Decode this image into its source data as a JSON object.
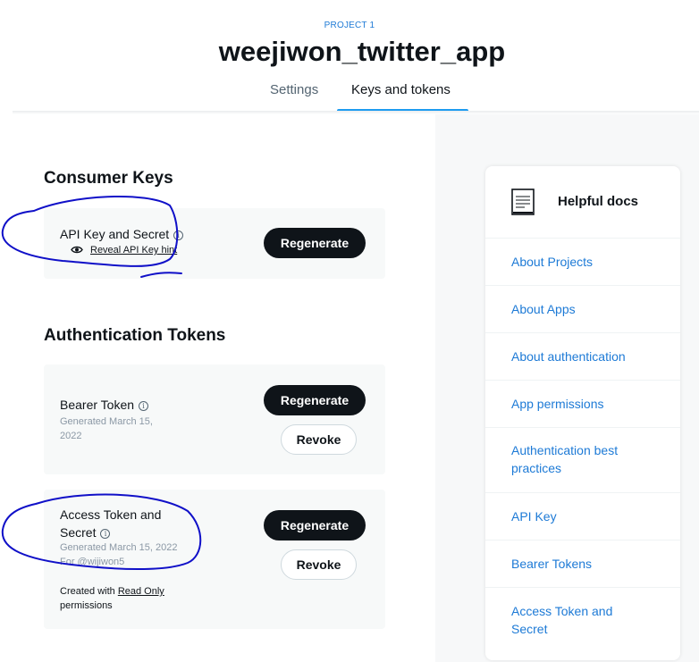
{
  "header": {
    "project_label": "PROJECT 1",
    "app_title": "weejiwon_twitter_app",
    "tabs": [
      {
        "label": "Settings",
        "active": false
      },
      {
        "label": "Keys and tokens",
        "active": true
      }
    ]
  },
  "consumer_keys": {
    "section_title": "Consumer Keys",
    "api_key": {
      "label": "API Key and Secret",
      "reveal_link": "Reveal API Key hint",
      "regenerate_label": "Regenerate"
    }
  },
  "auth_tokens": {
    "section_title": "Authentication Tokens",
    "bearer": {
      "label": "Bearer Token",
      "generated_line1": "Generated March 15,",
      "generated_line2": "2022",
      "regenerate_label": "Regenerate",
      "revoke_label": "Revoke"
    },
    "access": {
      "label_line1": "Access Token and",
      "label_line2": "Secret",
      "generated": "Generated March 15, 2022",
      "for_user": "For @wijiwon5",
      "created_with": "Created with",
      "permission_link": "Read Only",
      "permissions_word": "permissions",
      "regenerate_label": "Regenerate",
      "revoke_label": "Revoke"
    }
  },
  "helpful_docs": {
    "title": "Helpful docs",
    "links": [
      {
        "line1": "About Projects"
      },
      {
        "line1": "About Apps"
      },
      {
        "line1": "About authentication"
      },
      {
        "line1": "App permissions"
      },
      {
        "line1": "Authentication best",
        "line2": "practices"
      },
      {
        "line1": "API Key"
      },
      {
        "line1": "Bearer Tokens"
      },
      {
        "line1": "Access Token and",
        "line2": "Secret"
      }
    ]
  },
  "colors": {
    "accent_blue": "#1d9bf0",
    "link_blue": "#1d7ad6",
    "dark_button": "#0f1419",
    "annotation_ink": "#1010c8"
  }
}
